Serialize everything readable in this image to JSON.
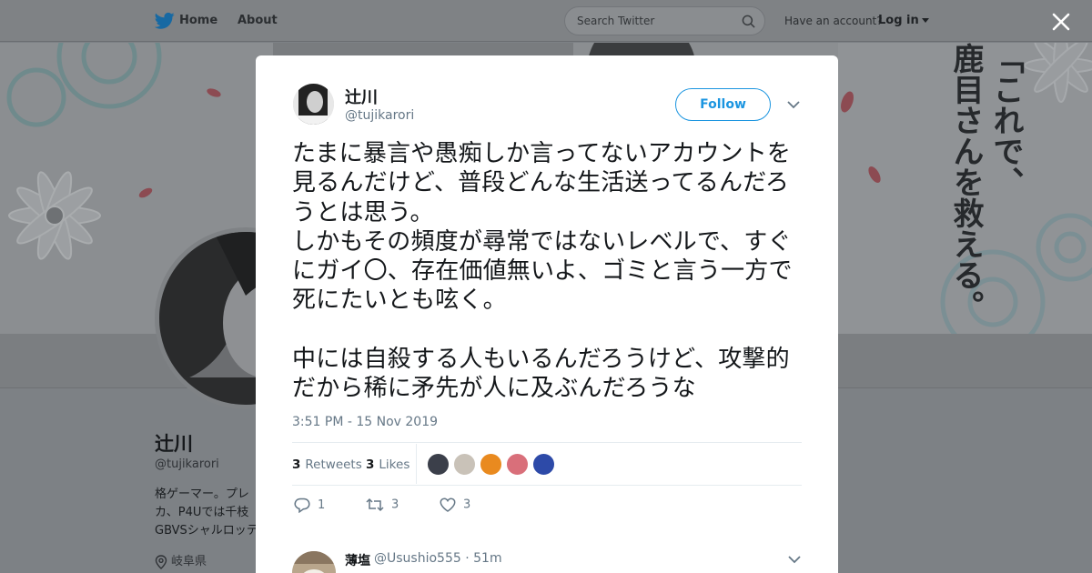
{
  "nav": {
    "home_label": "Home",
    "about_label": "About",
    "search_placeholder": "Search Twitter",
    "account_prompt": "Have an account?",
    "login_label": "Log in"
  },
  "banner": {
    "text_col1": "「これで、",
    "text_col2": "鹿目さんを救える。"
  },
  "profile": {
    "name": "辻川",
    "handle": "@tujikarori",
    "bio": "格ゲーマー。プレ\nカ、P4Uでは千枝\nGBVSシャルロッテ",
    "location": "岐阜県"
  },
  "tweet": {
    "author_name": "辻川",
    "author_handle": "@tujikarori",
    "follow_label": "Follow",
    "text": "たまに暴言や愚痴しか言ってないアカウントを見るんだけど、普段どんな生活送ってるんだろうとは思う。\nしかもその頻度が尋常ではないレベルで、すぐにガイ〇、存在価値無いよ、ゴミと言う一方で死にたいとも呟く。\n\n中には自殺する人もいるんだろうけど、攻撃的だから稀に矛先が人に及ぶんだろうな",
    "timestamp": "3:51 PM - 15 Nov 2019",
    "retweets_count": "3",
    "retweets_label": "Retweets",
    "likes_count": "3",
    "likes_label": "Likes",
    "reply_count": "1",
    "retweet_action_count": "3",
    "like_action_count": "3",
    "liker_colors": [
      "#3b3f4a",
      "#c9c2b8",
      "#e98a1f",
      "#d96f7a",
      "#2d4aa8"
    ]
  },
  "reply": {
    "name": "薄塩",
    "handle": "@Usushio555",
    "time": "51m"
  },
  "colors": {
    "twitter_blue": "#1da1f2",
    "follow_blue": "#1b95e0",
    "muted": "#657786"
  }
}
